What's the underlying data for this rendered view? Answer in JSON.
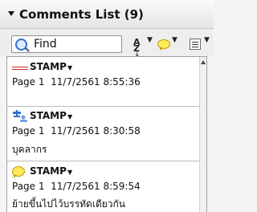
{
  "panel": {
    "title": "Comments List (9)",
    "search": {
      "value": "Find"
    },
    "toolbar": {
      "sort_icon": "sort-az-icon",
      "filter_icon": "comment-bubble-icon",
      "options_icon": "options-menu-icon",
      "sort_text": "A",
      "sort_text2": "Z"
    },
    "comments": [
      {
        "kind": "STAMP",
        "page": "Page 1",
        "datetime": "11/7/2561 8:55:36",
        "note": "",
        "icon": "stamp-icon"
      },
      {
        "kind": "STAMP",
        "page": "Page 1",
        "datetime": "11/7/2561 8:30:58",
        "note": "บุคลากร",
        "icon": "stamp-people-icon"
      },
      {
        "kind": "STAMP",
        "page": "Page 1",
        "datetime": "11/7/2561 8:59:54",
        "note": "ย้ายขึ้นไปไว้บรรทัดเดียวกัน",
        "icon": "comment-bubble-icon"
      }
    ]
  }
}
